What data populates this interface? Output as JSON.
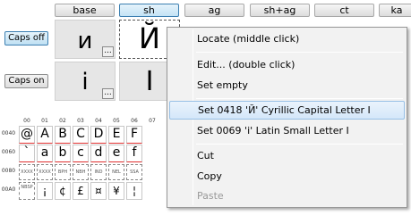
{
  "tabs": [
    {
      "label": "base"
    },
    {
      "label": "sh"
    },
    {
      "label": "ag"
    },
    {
      "label": "sh+ag"
    },
    {
      "label": "ct"
    },
    {
      "label": "ka"
    }
  ],
  "caps": {
    "off_label": "Caps off",
    "on_label": "Caps on"
  },
  "glyphs": {
    "caps_off_base": "и",
    "caps_off_sh": "Й",
    "caps_on_base": "і",
    "caps_on_sh": "І",
    "dots": "..."
  },
  "grid": {
    "columns": [
      "00",
      "01",
      "02",
      "03",
      "04",
      "05",
      "06"
    ],
    "rows": [
      {
        "code": "0040",
        "cells": [
          "@",
          "A",
          "B",
          "C",
          "D",
          "E",
          "F"
        ]
      },
      {
        "code": "0060",
        "cells": [
          "`",
          "a",
          "b",
          "c",
          "d",
          "e",
          "f"
        ]
      },
      {
        "code": "0080",
        "cells": [
          "XXXX",
          "XXXX",
          "BPH",
          "NBH",
          "IND",
          "NEL",
          "SSA"
        ]
      },
      {
        "code": "00A0",
        "cells": [
          "NBSP",
          "¡",
          "¢",
          "£",
          "¤",
          "¥",
          "¦"
        ]
      }
    ]
  },
  "context_menu": {
    "locate": "Locate (middle click)",
    "edit": "Edit... (double click)",
    "set_empty": "Set empty",
    "set_0418": "Set 0418 'Й' Cyrillic Capital Letter I",
    "set_0069": "Set 0069 'i' Latin Small Letter I",
    "cut": "Cut",
    "copy": "Copy",
    "paste": "Paste"
  }
}
